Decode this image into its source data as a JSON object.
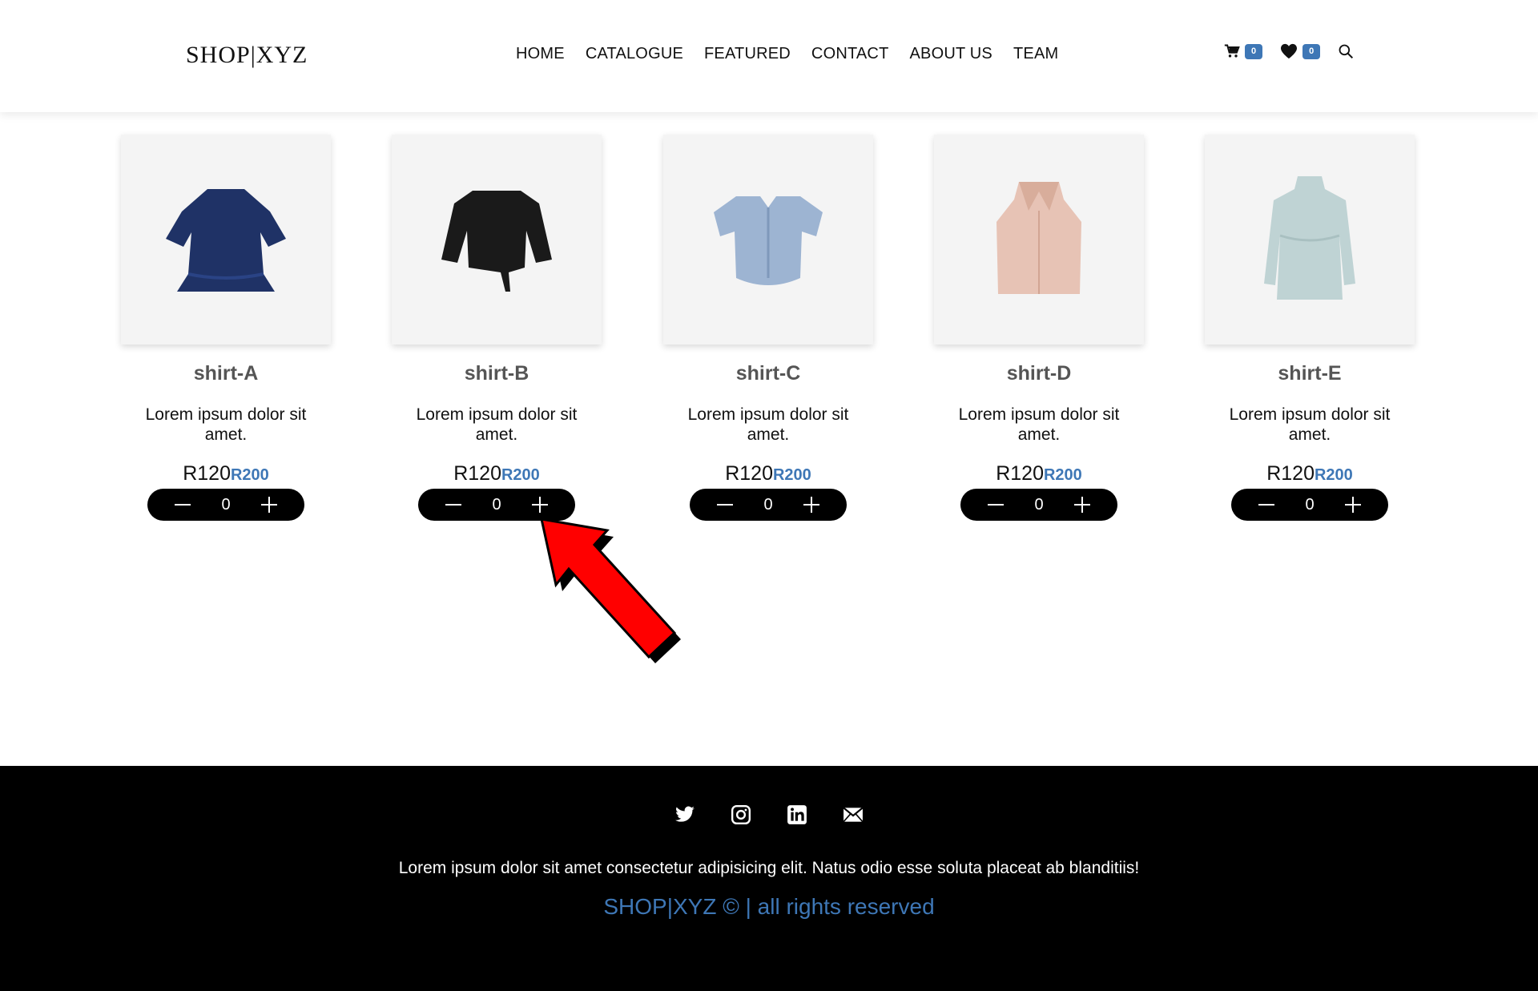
{
  "header": {
    "logo": "SHOP|XYZ",
    "nav": [
      "HOME",
      "CATALOGUE",
      "FEATURED",
      "CONTACT",
      "ABOUT US",
      "TEAM"
    ],
    "cart_count": "0",
    "wishlist_count": "0",
    "icons": [
      "cart-icon",
      "heart-icon",
      "search-icon"
    ]
  },
  "products": [
    {
      "name": "shirt-A",
      "desc": "Lorem ipsum dolor sit amet.",
      "price": "R120",
      "old_price": "R200",
      "qty": "0",
      "color": "#1f3266"
    },
    {
      "name": "shirt-B",
      "desc": "Lorem ipsum dolor sit amet.",
      "price": "R120",
      "old_price": "R200",
      "qty": "0",
      "color": "#1a1a1a"
    },
    {
      "name": "shirt-C",
      "desc": "Lorem ipsum dolor sit amet.",
      "price": "R120",
      "old_price": "R200",
      "qty": "0",
      "color": "#9db4d2"
    },
    {
      "name": "shirt-D",
      "desc": "Lorem ipsum dolor sit amet.",
      "price": "R120",
      "old_price": "R200",
      "qty": "0",
      "color": "#e7c3b5"
    },
    {
      "name": "shirt-E",
      "desc": "Lorem ipsum dolor sit amet.",
      "price": "R120",
      "old_price": "R200",
      "qty": "0",
      "color": "#bfd3d4"
    }
  ],
  "footer": {
    "social": [
      "twitter-icon",
      "instagram-icon",
      "linkedin-icon",
      "mail-icon"
    ],
    "text": "Lorem ipsum dolor sit amet consectetur adipisicing elit. Natus odio esse soluta placeat ab blanditiis!",
    "copyright": "SHOP|XYZ © | all rights reserved"
  },
  "colors": {
    "accent": "#3e77b6",
    "annotation_arrow": "#ff0000"
  }
}
